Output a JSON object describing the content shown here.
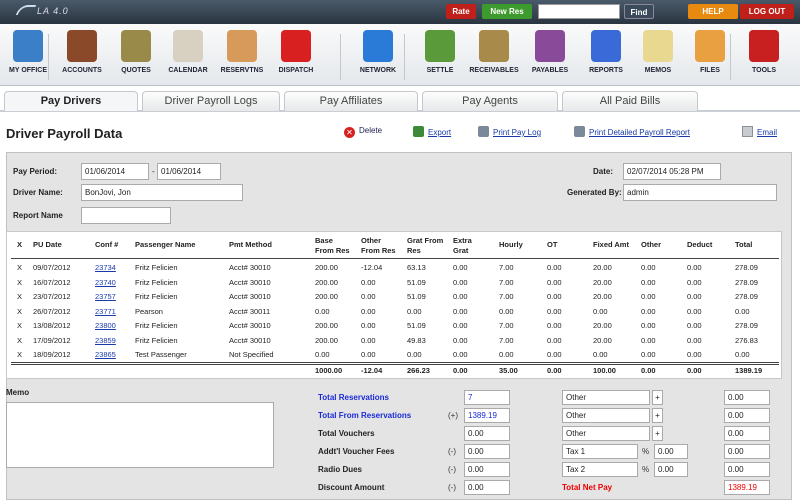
{
  "app": {
    "name": "LA 4.0"
  },
  "topbar": {
    "rate": "Rate",
    "new_res": "New Res",
    "search_value": "",
    "find": "Find",
    "help": "HELP",
    "logout": "LOG OUT"
  },
  "toolbar": [
    {
      "label": "MY OFFICE",
      "icon": "office-building-icon",
      "color": "#3a7fc8"
    },
    {
      "label": "ACCOUNTS",
      "icon": "ledger-book-icon",
      "color": "#8a4a2a"
    },
    {
      "label": "QUOTES",
      "icon": "money-bag-icon",
      "color": "#9a8a4a"
    },
    {
      "label": "CALENDAR",
      "icon": "calendar-icon",
      "color": "#d8d0c0"
    },
    {
      "label": "RESERVTNS",
      "icon": "notepad-pencil-icon",
      "color": "#d89a5a"
    },
    {
      "label": "DISPATCH",
      "icon": "red-car-icon",
      "color": "#d82020"
    },
    {
      "label": "NETWORK",
      "icon": "globe-icon",
      "color": "#2a7ad8"
    },
    {
      "label": "SETTLE",
      "icon": "cash-icon",
      "color": "#5a9a3a"
    },
    {
      "label": "RECEIVABLES",
      "icon": "inbox-tray-icon",
      "color": "#a88a4a"
    },
    {
      "label": "PAYABLES",
      "icon": "outbox-tray-icon",
      "color": "#8a4a9a"
    },
    {
      "label": "REPORTS",
      "icon": "pie-chart-icon",
      "color": "#3a6ad8"
    },
    {
      "label": "MEMOS",
      "icon": "sticky-note-icon",
      "color": "#e8d890"
    },
    {
      "label": "FILES",
      "icon": "folder-icon",
      "color": "#e8a040"
    },
    {
      "label": "TOOLS",
      "icon": "wrench-screwdriver-icon",
      "color": "#c82020"
    }
  ],
  "tabs": [
    "Pay Drivers",
    "Driver Payroll Logs",
    "Pay Affiliates",
    "Pay Agents",
    "All Paid Bills"
  ],
  "page": {
    "title": "Driver Payroll Data"
  },
  "actions": {
    "delete": "Delete",
    "export": "Export",
    "print_pay_log": "Print Pay Log",
    "print_detailed": "Print Detailed Payroll Report",
    "email": "Email"
  },
  "form": {
    "pay_period_label": "Pay Period:",
    "pay_period_from": "01/06/2014",
    "pay_period_sep": "-",
    "pay_period_to": "01/06/2014",
    "driver_name_label": "Driver Name:",
    "driver_name": "BonJovi, Jon",
    "report_name_label": "Report Name",
    "report_name": "",
    "date_label": "Date:",
    "date": "02/07/2014 05:28 PM",
    "generated_by_label": "Generated By:",
    "generated_by": "admin"
  },
  "table": {
    "headers": {
      "x": "X",
      "pu_date": "PU Date",
      "conf": "Conf #",
      "passenger": "Passenger Name",
      "pmt": "Pmt Method",
      "base1": "Base",
      "base2": "From Res",
      "other1": "Other",
      "other2": "From Res",
      "grat1": "Grat From",
      "grat2": "Res",
      "extra1": "Extra",
      "extra2": "Grat",
      "hourly": "Hourly",
      "ot": "OT",
      "fixed": "Fixed Amt",
      "oth": "Other",
      "deduct": "Deduct",
      "total": "Total"
    },
    "rows": [
      {
        "x": "X",
        "pu": "09/07/2012",
        "conf": "23734",
        "pass": "Fritz Felicien",
        "pmt": "Acct# 30010",
        "base": "200.00",
        "other": "-12.04",
        "grat": "63.13",
        "extra": "0.00",
        "hourly": "7.00",
        "ot": "0.00",
        "fixed": "20.00",
        "oth": "0.00",
        "deduct": "0.00",
        "total": "278.09"
      },
      {
        "x": "X",
        "pu": "16/07/2012",
        "conf": "23740",
        "pass": "Fritz Felicien",
        "pmt": "Acct# 30010",
        "base": "200.00",
        "other": "0.00",
        "grat": "51.09",
        "extra": "0.00",
        "hourly": "7.00",
        "ot": "0.00",
        "fixed": "20.00",
        "oth": "0.00",
        "deduct": "0.00",
        "total": "278.09"
      },
      {
        "x": "X",
        "pu": "23/07/2012",
        "conf": "23757",
        "pass": "Fritz Felicien",
        "pmt": "Acct# 30010",
        "base": "200.00",
        "other": "0.00",
        "grat": "51.09",
        "extra": "0.00",
        "hourly": "7.00",
        "ot": "0.00",
        "fixed": "20.00",
        "oth": "0.00",
        "deduct": "0.00",
        "total": "278.09"
      },
      {
        "x": "X",
        "pu": "26/07/2012",
        "conf": "23771",
        "pass": "Pearson",
        "pmt": "Acct# 30011",
        "base": "0.00",
        "other": "0.00",
        "grat": "0.00",
        "extra": "0.00",
        "hourly": "0.00",
        "ot": "0.00",
        "fixed": "0.00",
        "oth": "0.00",
        "deduct": "0.00",
        "total": "0.00"
      },
      {
        "x": "X",
        "pu": "13/08/2012",
        "conf": "23800",
        "pass": "Fritz Felicien",
        "pmt": "Acct# 30010",
        "base": "200.00",
        "other": "0.00",
        "grat": "51.09",
        "extra": "0.00",
        "hourly": "7.00",
        "ot": "0.00",
        "fixed": "20.00",
        "oth": "0.00",
        "deduct": "0.00",
        "total": "278.09"
      },
      {
        "x": "X",
        "pu": "17/09/2012",
        "conf": "23859",
        "pass": "Fritz Felicien",
        "pmt": "Acct# 30010",
        "base": "200.00",
        "other": "0.00",
        "grat": "49.83",
        "extra": "0.00",
        "hourly": "7.00",
        "ot": "0.00",
        "fixed": "20.00",
        "oth": "0.00",
        "deduct": "0.00",
        "total": "276.83"
      },
      {
        "x": "X",
        "pu": "18/09/2012",
        "conf": "23865",
        "pass": "Test Passenger",
        "pmt": "Not Specified",
        "base": "0.00",
        "other": "0.00",
        "grat": "0.00",
        "extra": "0.00",
        "hourly": "0.00",
        "ot": "0.00",
        "fixed": "0.00",
        "oth": "0.00",
        "deduct": "0.00",
        "total": "0.00"
      }
    ],
    "totals": {
      "base": "1000.00",
      "other": "-12.04",
      "grat": "266.23",
      "extra": "0.00",
      "hourly": "35.00",
      "ot": "0.00",
      "fixed": "100.00",
      "oth": "0.00",
      "deduct": "0.00",
      "total": "1389.19"
    }
  },
  "memo": {
    "label": "Memo",
    "value": ""
  },
  "summary": {
    "total_reservations_label": "Total Reservations",
    "total_reservations": "7",
    "total_from_res_label": "Total From Reservations",
    "total_from_res_op": "(+)",
    "total_from_res": "1389.19",
    "total_vouchers_label": "Total Vouchers",
    "total_vouchers": "0.00",
    "addtl_voucher_label": "Addt'l Voucher Fees",
    "addtl_voucher_op": "(-)",
    "addtl_voucher": "0.00",
    "radio_dues_label": "Radio Dues",
    "radio_dues_op": "(-)",
    "radio_dues": "0.00",
    "discount_label": "Discount Amount",
    "discount_op": "(-)",
    "discount": "0.00",
    "other1": "Other",
    "other1_sign": "+",
    "other1_val": "0.00",
    "other2": "Other",
    "other2_sign": "+",
    "other2_val": "0.00",
    "other3": "Other",
    "other3_sign": "+",
    "other3_val": "0.00",
    "tax1": "Tax 1",
    "tax1_pct": "%",
    "tax1_rate": "0.00",
    "tax1_val": "0.00",
    "tax2": "Tax 2",
    "tax2_pct": "%",
    "tax2_rate": "0.00",
    "tax2_val": "0.00",
    "net_pay_label": "Total Net Pay",
    "net_pay": "1389.19"
  }
}
